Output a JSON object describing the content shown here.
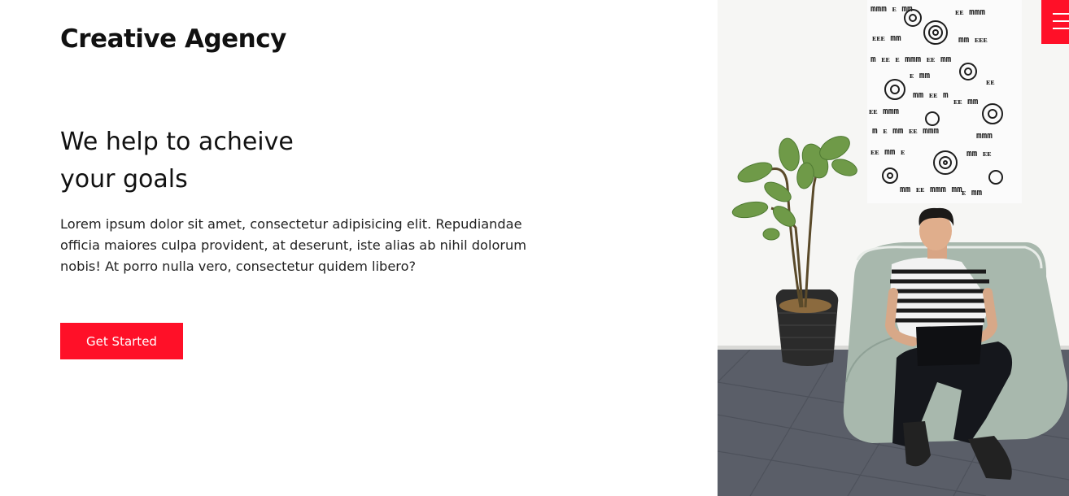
{
  "header": {
    "brand": "Creative Agency",
    "menu_icon": "hamburger-menu-icon"
  },
  "hero": {
    "headline_line1": "We help to acheive",
    "headline_line2": "your goals",
    "description": "Lorem ipsum dolor sit amet, consectetur adipisicing elit. Repudiandae officia maiores culpa provident, at deserunt, iste alias ab nihil dolorum nobis! At porro nulla vero, consectetur quidem libero?",
    "cta_label": "Get Started"
  },
  "colors": {
    "accent": "#ff1028",
    "text": "#111111",
    "background": "#ffffff"
  }
}
